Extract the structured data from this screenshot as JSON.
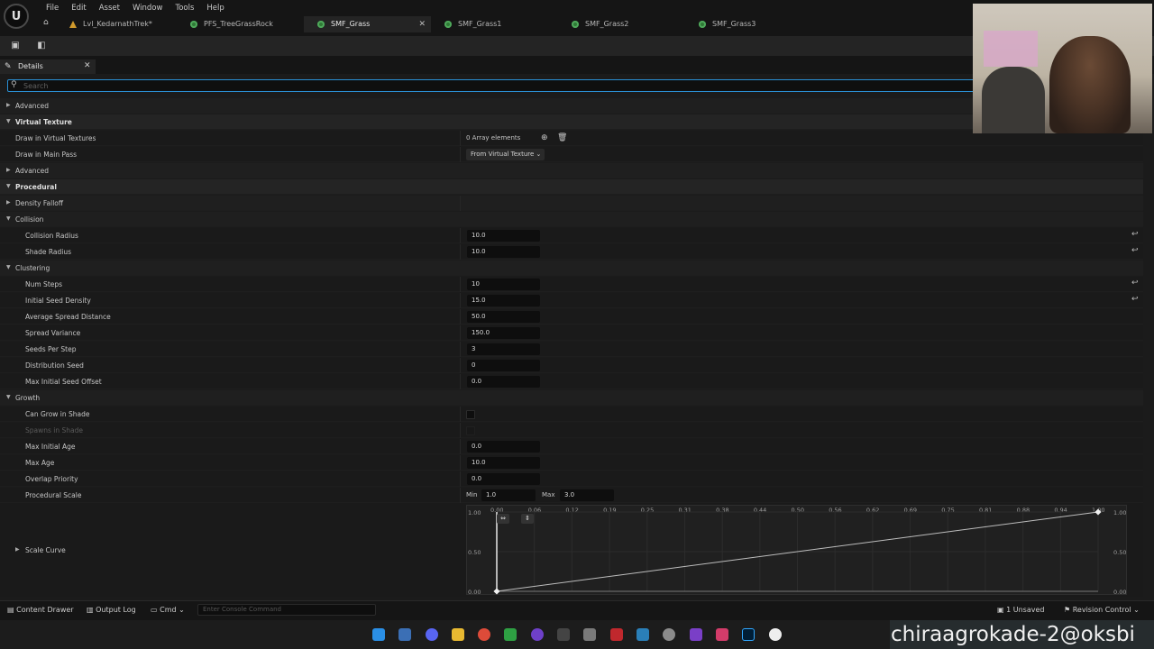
{
  "menu": [
    "File",
    "Edit",
    "Asset",
    "Window",
    "Tools",
    "Help"
  ],
  "tabs": [
    {
      "label": "Lvl_KedarnathTrek*",
      "icon": "level-icon",
      "active": false
    },
    {
      "label": "PFS_TreeGrassRock",
      "icon": "foliage-icon",
      "active": false
    },
    {
      "label": "SMF_Grass",
      "icon": "foliage-icon",
      "active": true
    },
    {
      "label": "SMF_Grass1",
      "icon": "foliage-icon",
      "active": false
    },
    {
      "label": "SMF_Grass2",
      "icon": "foliage-icon",
      "active": false
    },
    {
      "label": "SMF_Grass3",
      "icon": "foliage-icon",
      "active": false
    }
  ],
  "details": {
    "title": "Details",
    "search_placeholder": "Search"
  },
  "rows": {
    "advanced1": "Advanced",
    "virtual_texture": "Virtual Texture",
    "draw_in_vt": "Draw in Virtual Textures",
    "draw_in_vt_value": "0 Array elements",
    "draw_in_main_pass": "Draw in Main Pass",
    "draw_in_main_pass_value": "From Virtual Texture",
    "advanced2": "Advanced",
    "procedural": "Procedural",
    "density_falloff": "Density Falloff",
    "collision": "Collision",
    "collision_radius": "Collision Radius",
    "collision_radius_value": "10.0",
    "shade_radius": "Shade Radius",
    "shade_radius_value": "10.0",
    "clustering": "Clustering",
    "num_steps": "Num Steps",
    "num_steps_value": "10",
    "initial_seed_density": "Initial Seed Density",
    "initial_seed_density_value": "15.0",
    "average_spread_distance": "Average Spread Distance",
    "average_spread_distance_value": "50.0",
    "spread_variance": "Spread Variance",
    "spread_variance_value": "150.0",
    "seeds_per_step": "Seeds Per Step",
    "seeds_per_step_value": "3",
    "distribution_seed": "Distribution Seed",
    "distribution_seed_value": "0",
    "max_initial_seed_offset": "Max Initial Seed Offset",
    "max_initial_seed_offset_value": "0.0",
    "growth": "Growth",
    "can_grow_in_shade": "Can Grow in Shade",
    "spawns_in_shade": "Spawns in Shade",
    "max_initial_age": "Max Initial Age",
    "max_initial_age_value": "0.0",
    "max_age": "Max Age",
    "max_age_value": "10.0",
    "overlap_priority": "Overlap Priority",
    "overlap_priority_value": "0.0",
    "procedural_scale": "Procedural Scale",
    "scale_min_label": "Min",
    "scale_min_value": "1.0",
    "scale_max_label": "Max",
    "scale_max_value": "3.0",
    "scale_curve": "Scale Curve"
  },
  "curve": {
    "x_ticks": [
      "0.00",
      "0.06",
      "0.12",
      "0.19",
      "0.25",
      "0.31",
      "0.38",
      "0.44",
      "0.50",
      "0.56",
      "0.62",
      "0.69",
      "0.75",
      "0.81",
      "0.88",
      "0.94",
      "1.00"
    ],
    "y_ticks": [
      "1.00",
      "0.50",
      "0.00"
    ]
  },
  "statusbar": {
    "content_drawer": "Content Drawer",
    "output_log": "Output Log",
    "cmd": "Cmd",
    "console_placeholder": "Enter Console Command",
    "unsaved": "1 Unsaved",
    "revision_control": "Revision Control"
  },
  "watermark": "chiraagrokade-2@oksbi",
  "colors": {
    "accent": "#2a8fd4",
    "panel": "#1b1b1b",
    "foliage_icon": "#4fa85b"
  }
}
